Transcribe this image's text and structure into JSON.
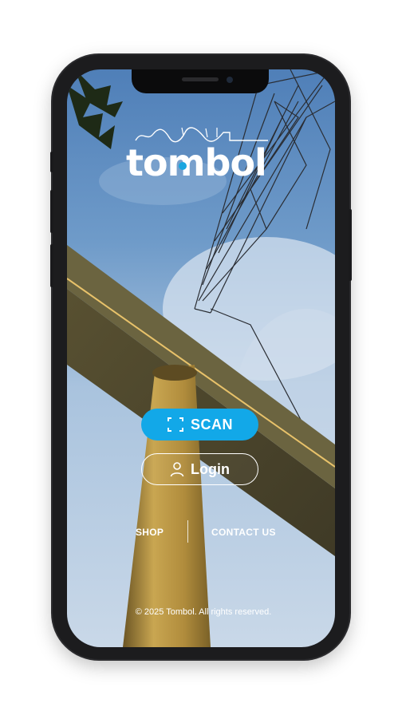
{
  "brand": {
    "logo_text": "tombol",
    "accent_color": "#1aa6e0"
  },
  "actions": {
    "scan_label": "SCAN",
    "scan_icon": "scan-frame-icon",
    "login_label": "Login",
    "login_icon": "user-icon",
    "primary_color": "#12a8e8"
  },
  "nav": {
    "shop_label": "SHOP",
    "contact_label": "CONTACT US"
  },
  "footer": {
    "copyright": "© 2025 Tombol. All rights reserved."
  }
}
